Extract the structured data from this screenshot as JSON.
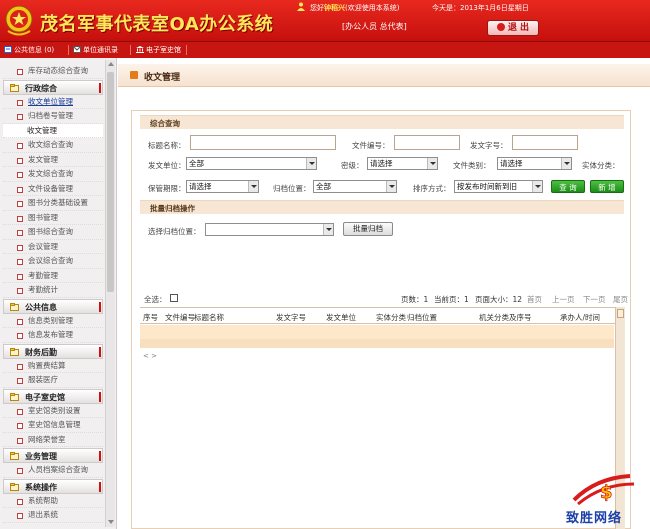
{
  "header": {
    "app_title": "茂名军事代表室OA办公系统",
    "greeting_prefix": "您好",
    "user_name": "钟稻兴",
    "greeting_suffix": "欢迎使用本系统",
    "role": "[办公人员 总代表]",
    "today": "今天是：2013年1月6日星期日",
    "logout_label": "退 出"
  },
  "nav": {
    "items": [
      {
        "label": "公共信息 (0)",
        "icon": "public-info-icon"
      },
      {
        "label": "单位通讯录",
        "icon": "mail-icon"
      },
      {
        "label": "电子室史馆",
        "icon": "museum-icon"
      }
    ]
  },
  "sidebar": {
    "entries": [
      {
        "kind": "item",
        "label": "库存动态综合查询"
      },
      {
        "kind": "group",
        "label": "行政综合"
      },
      {
        "kind": "item",
        "label": "收文单位管理",
        "state": "link"
      },
      {
        "kind": "item",
        "label": "归档卷号管理"
      },
      {
        "kind": "item",
        "label": "收文管理",
        "state": "current"
      },
      {
        "kind": "item",
        "label": "收文综合查询"
      },
      {
        "kind": "item",
        "label": "发文管理"
      },
      {
        "kind": "item",
        "label": "发文综合查询"
      },
      {
        "kind": "item",
        "label": "文件设备管理"
      },
      {
        "kind": "item",
        "label": "图书分类基础设置"
      },
      {
        "kind": "item",
        "label": "图书管理"
      },
      {
        "kind": "item",
        "label": "图书综合查询"
      },
      {
        "kind": "item",
        "label": "会议管理"
      },
      {
        "kind": "item",
        "label": "会议综合查询"
      },
      {
        "kind": "item",
        "label": "考勤管理"
      },
      {
        "kind": "item",
        "label": "考勤统计"
      },
      {
        "kind": "group",
        "label": "公共信息"
      },
      {
        "kind": "item",
        "label": "信息类别管理"
      },
      {
        "kind": "item",
        "label": "信息发布管理"
      },
      {
        "kind": "group",
        "label": "财务后勤"
      },
      {
        "kind": "item",
        "label": "购置费结算"
      },
      {
        "kind": "item",
        "label": "服装医疗"
      },
      {
        "kind": "group",
        "label": "电子室史馆"
      },
      {
        "kind": "item",
        "label": "室史馆类别设置"
      },
      {
        "kind": "item",
        "label": "室史馆信息管理"
      },
      {
        "kind": "item",
        "label": "网络荣誉室"
      },
      {
        "kind": "group",
        "label": "业务管理"
      },
      {
        "kind": "item",
        "label": "人员档案综合查询"
      },
      {
        "kind": "group",
        "label": "系统操作"
      },
      {
        "kind": "item",
        "label": "系统帮助"
      },
      {
        "kind": "item",
        "label": "退出系统"
      }
    ]
  },
  "main": {
    "page_title": "收文管理",
    "search_section": "综合查询",
    "labels": {
      "title_name": "标题名称：",
      "doc_number": "文件编号：",
      "doc_char": "发文字号：",
      "issuing_unit": "发文单位：",
      "secrecy": "密级：",
      "doc_category": "文件类别：",
      "entity_category": "实体分类：",
      "retention": "保管期限：",
      "archive_location": "归档位置：",
      "sort_by": "排序方式："
    },
    "selects": {
      "issuing_unit": "全部",
      "secrecy": "请选择",
      "doc_category": "请选择",
      "retention": "请选择",
      "archive_location": "全部",
      "sort_by": "按发布时间新到旧"
    },
    "inputs": {
      "title_name": "",
      "doc_number": "",
      "doc_char": ""
    },
    "buttons": {
      "query": "查 询",
      "add": "新 增",
      "batch_archive": "批量归档"
    },
    "batch_section": "批量归档操作",
    "batch_label": "选择归档位置：",
    "batch_select": "",
    "select_all": "全选：",
    "pager": {
      "pages": "页数：1",
      "current": "当前页：1",
      "page_size": "页面大小：12",
      "first": "首页",
      "prev": "上一页",
      "next": "下一页",
      "last": "尾页"
    },
    "table_headers": [
      "序号",
      "文件编号",
      "标题名称",
      "发文字号",
      "发文单位",
      "实体分类",
      "归档位置",
      "机关分类及序号",
      "承办人/时间"
    ],
    "hscroll_hint": "< >"
  },
  "watermark": {
    "text": "致胜网络"
  },
  "colors": {
    "brand_red": "#c60f0d",
    "title_yellow": "#ffe65a",
    "section_beige": "#f7e6d3",
    "row_highlight": "#fde8c9",
    "action_green": "#2aa126",
    "watermark_blue": "#1d3fa8"
  }
}
